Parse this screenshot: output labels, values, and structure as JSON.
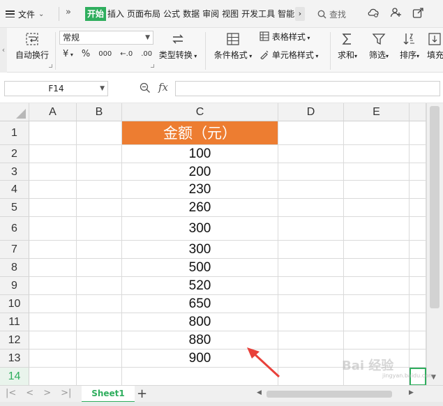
{
  "menubar": {
    "file_label": "文件",
    "more_label": "»",
    "tabs": [
      "开始",
      "插入",
      "页面布局",
      "公式",
      "数据",
      "审阅",
      "视图",
      "开发工具",
      "智能"
    ],
    "tab_more": "›",
    "search_label": "查找",
    "icons": [
      "cloud-sync-icon",
      "share-user-icon",
      "share-icon"
    ]
  },
  "ribbon": {
    "wrap_label": "自动换行",
    "number_format": "常规",
    "currency_symbol": "¥",
    "percent_symbol": "%",
    "thousands_symbol": "000",
    "inc_decimal_symbol": "←.0",
    "dec_decimal_symbol": ".00",
    "type_convert_label": "类型转换",
    "cond_format_label": "条件格式",
    "table_style_label": "表格样式",
    "cell_style_label": "单元格样式",
    "sum_label": "求和",
    "filter_label": "筛选",
    "sort_label": "排序",
    "fill_label": "填充"
  },
  "formula_bar": {
    "cell_ref": "F14",
    "fx_label": "fx",
    "formula": ""
  },
  "grid": {
    "columns": [
      "A",
      "B",
      "C",
      "D",
      "E"
    ],
    "rows": [
      "1",
      "2",
      "3",
      "4",
      "5",
      "6",
      "7",
      "8",
      "9",
      "10",
      "11",
      "12",
      "13",
      "14"
    ],
    "selected_row": "14",
    "header_cell": "金额（元）",
    "values": [
      "100",
      "200",
      "230",
      "260",
      "300",
      "300",
      "500",
      "520",
      "650",
      "800",
      "880",
      "900"
    ]
  },
  "sheets": {
    "active": "Sheet1",
    "add_label": "+"
  },
  "colors": {
    "accent": "#2fae5e",
    "header_fill": "#ed7d31",
    "annotation": "#e8403a"
  },
  "watermark": {
    "brand": "Bai 经验",
    "url": "jingyan.baidu.com"
  }
}
